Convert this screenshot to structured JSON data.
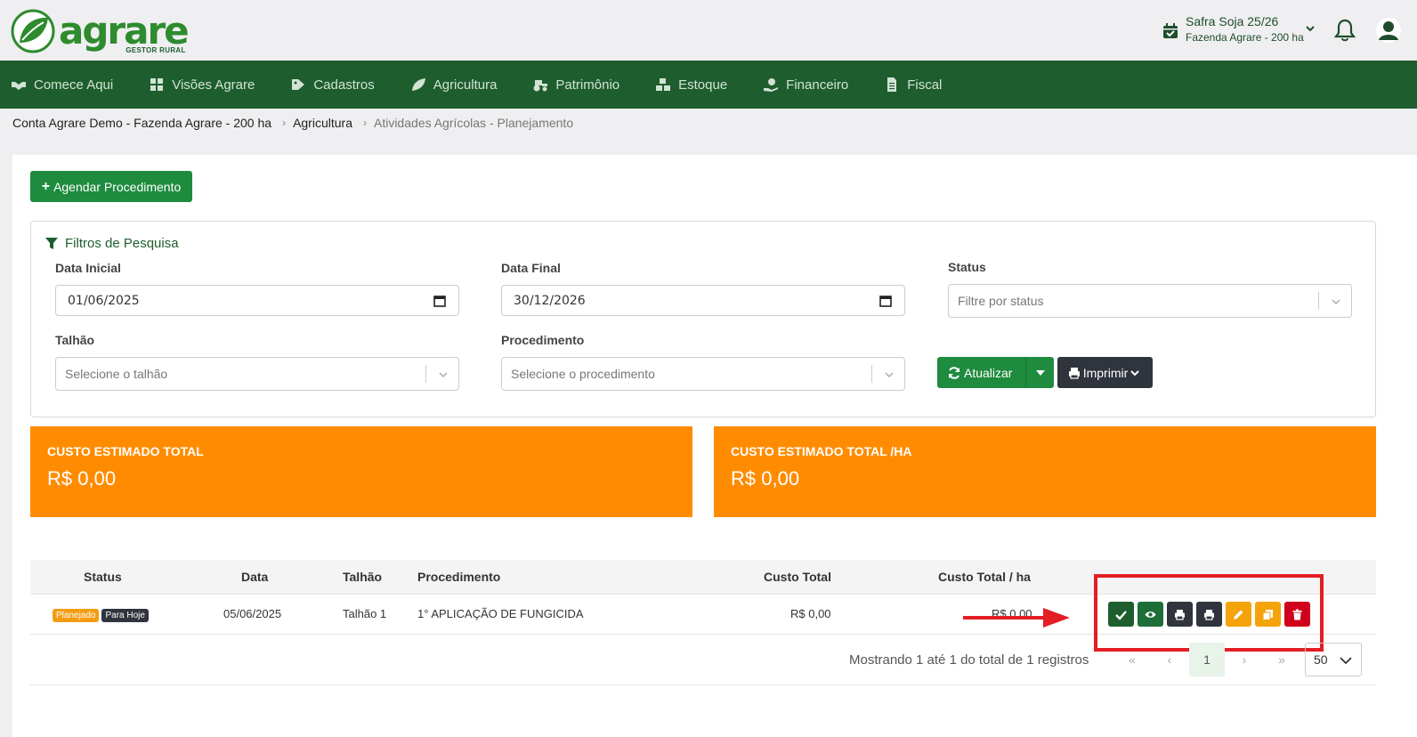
{
  "brand": {
    "name": "agrare",
    "tagline": "GESTOR RURAL"
  },
  "header": {
    "season_title": "Safra Soja 25/26",
    "season_farm": "Fazenda Agrare - 200 ha",
    "icons": [
      "calendar-check-icon",
      "chevron-down-icon",
      "bell-icon",
      "user-icon"
    ]
  },
  "nav": [
    {
      "label": "Comece Aqui",
      "icon": "handshake-icon"
    },
    {
      "label": "Visões Agrare",
      "icon": "grid-icon"
    },
    {
      "label": "Cadastros",
      "icon": "tag-icon"
    },
    {
      "label": "Agricultura",
      "icon": "leaf-icon"
    },
    {
      "label": "Patrimônio",
      "icon": "tractor-icon"
    },
    {
      "label": "Estoque",
      "icon": "boxes-icon"
    },
    {
      "label": "Financeiro",
      "icon": "money-hand-icon"
    },
    {
      "label": "Fiscal",
      "icon": "document-icon"
    }
  ],
  "breadcrumb": [
    "Conta Agrare Demo - Fazenda Agrare - 200 ha",
    "Agricultura",
    "Atividades Agrícolas - Planejamento"
  ],
  "actions": {
    "new_label": "Agendar Procedimento",
    "update_label": "Atualizar",
    "print_label": "Imprimir"
  },
  "filters": {
    "title": "Filtros de Pesquisa",
    "start_label": "Data Inicial",
    "start_value": "01/06/2025",
    "end_label": "Data Final",
    "end_value": "30/12/2026",
    "status_label": "Status",
    "status_placeholder": "Filtre por status",
    "plot_label": "Talhão",
    "plot_placeholder": "Selecione o talhão",
    "procedure_label": "Procedimento",
    "procedure_placeholder": "Selecione o procedimento"
  },
  "stats": [
    {
      "label": "CUSTO ESTIMADO TOTAL",
      "value": "R$ 0,00"
    },
    {
      "label": "CUSTO ESTIMADO TOTAL /HA",
      "value": "R$ 0,00"
    }
  ],
  "table": {
    "headers": [
      "Status",
      "Data",
      "Talhão",
      "Procedimento",
      "Custo Total",
      "Custo Total / ha"
    ],
    "rows": [
      {
        "badges": [
          "Planejado",
          "Para Hoje"
        ],
        "date": "05/06/2025",
        "plot": "Talhão 1",
        "procedure": "1° APLICAÇÃO DE FUNGICIDA",
        "total": "R$ 0,00",
        "per_ha": "R$ 0,00"
      }
    ],
    "row_actions": [
      "check-icon",
      "eye-icon",
      "printer-icon",
      "printer-icon",
      "pencil-icon",
      "copy-icon",
      "trash-icon"
    ]
  },
  "pagination": {
    "info": "Mostrando 1 até 1 do total de 1 registros",
    "first": "«",
    "prev": "‹",
    "current": "1",
    "next": "›",
    "last": "»",
    "page_size": "50"
  },
  "colors": {
    "brand_green": "#1e5e2e",
    "button_green": "#1e8b3e",
    "stat_orange": "#ff8c00",
    "highlight_red": "#e31e24"
  }
}
